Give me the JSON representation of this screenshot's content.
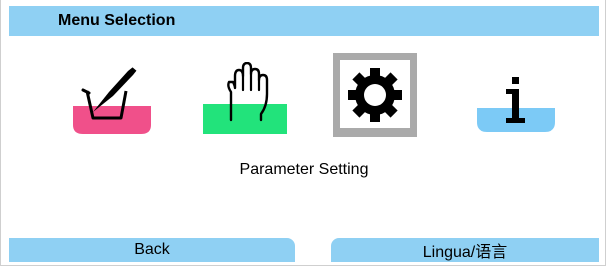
{
  "header": {
    "title": "Menu Selection"
  },
  "menu": {
    "items": [
      {
        "id": "calibration",
        "icon": "beaker-pencil-icon",
        "accent": "#f0508a",
        "selected": false
      },
      {
        "id": "maintenance",
        "icon": "hand-icon",
        "accent": "#22e37b",
        "selected": false
      },
      {
        "id": "parameter-setting",
        "icon": "gear-icon",
        "accent": "#aaaaaa",
        "selected": true
      },
      {
        "id": "diagnostics",
        "icon": "info-icon",
        "accent": "#7ccaf6",
        "selected": false
      }
    ],
    "selected_label": "Parameter Setting"
  },
  "softkeys": {
    "left_label": "Back",
    "right_label": "Lingua/语言"
  },
  "colors": {
    "bar": "#8fd0f3",
    "background": "#ffffff"
  }
}
